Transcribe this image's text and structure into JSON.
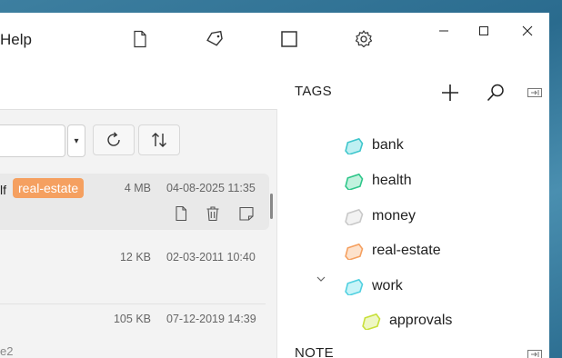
{
  "menu": {
    "help": "Help"
  },
  "toolbar": {
    "new_file_icon": "file-icon",
    "tag_icon": "tag-icon",
    "maximize_view_icon": "square-icon",
    "settings_icon": "gear-icon"
  },
  "file_list": {
    "rows": [
      {
        "name_fragment": "lf",
        "tag": "real-estate",
        "tag_color": "#f5a060",
        "size": "4 MB",
        "date": "04-08-2025 11:35",
        "selected": true
      },
      {
        "name_fragment": "",
        "size": "12 KB",
        "date": "02-03-2011 10:40",
        "sub": ""
      },
      {
        "name_fragment": "",
        "size": "105 KB",
        "date": "07-12-2019 14:39",
        "sub": "e2"
      }
    ]
  },
  "tags_panel": {
    "title": "TAGS",
    "items": [
      {
        "label": "bank",
        "color": "#3fc6cc"
      },
      {
        "label": "health",
        "color": "#2fc68a"
      },
      {
        "label": "money",
        "color": "#c8c8c8"
      },
      {
        "label": "real-estate",
        "color": "#f5a060"
      },
      {
        "label": "work",
        "color": "#50d0e0",
        "expanded": true
      },
      {
        "label": "approvals",
        "color": "#c8e03a",
        "child_of": "work"
      }
    ]
  },
  "note_panel": {
    "title": "NOTE"
  }
}
